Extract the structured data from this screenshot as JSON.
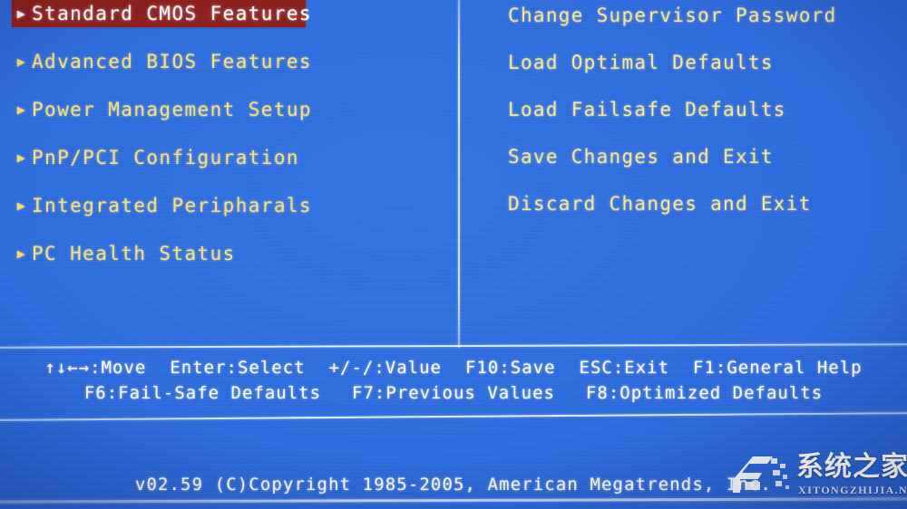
{
  "screen": {
    "background_color": "#2a68dd",
    "text_color_menu": "#f3e489",
    "text_color_white": "#ffffff",
    "highlight_background_color": "#8d1d1c"
  },
  "left_menu": {
    "bullet_glyph": "▶",
    "items": [
      {
        "label": "Standard CMOS Features",
        "selected": true
      },
      {
        "label": "Advanced BIOS Features",
        "selected": false
      },
      {
        "label": "Power Management Setup",
        "selected": false
      },
      {
        "label": "PnP/PCI Configuration",
        "selected": false
      },
      {
        "label": "Integrated Peripharals",
        "selected": false
      },
      {
        "label": "PC Health Status",
        "selected": false
      }
    ]
  },
  "right_menu": {
    "items": [
      {
        "label": "Change Supervisor Password"
      },
      {
        "label": "Load Optimal Defaults"
      },
      {
        "label": "Load Failsafe Defaults"
      },
      {
        "label": "Save Changes and Exit"
      },
      {
        "label": "Discard Changes and Exit"
      }
    ]
  },
  "help_bar": {
    "row1": [
      "↑↓←→:Move",
      "Enter:Select",
      "+/-/:Value",
      "F10:Save",
      "ESC:Exit",
      "F1:General Help"
    ],
    "row2": [
      "F6:Fail-Safe Defaults",
      "F7:Previous Values",
      "F8:Optimized Defaults"
    ]
  },
  "footer": {
    "copyright": "v02.59 (C)Copyright 1985-2005, American Megatrends, Inc."
  },
  "watermark": {
    "chinese_text": "系统之家",
    "url_text": "XITONGZHIJIA.NET"
  }
}
